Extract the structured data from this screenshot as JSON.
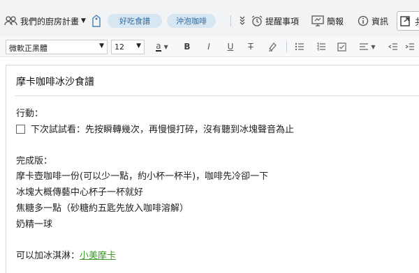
{
  "toolbar": {
    "notebook_name": "我們的廚房計畫",
    "tags": [
      "好吃食譜",
      "沖泡咖啡"
    ],
    "reminder_label": "提醒事項",
    "presentation_label": "簡報",
    "info_label": "資訊",
    "share_label": "共"
  },
  "format": {
    "font": "微軟正黑體",
    "size": "12",
    "buttons": [
      "text-color",
      "bold",
      "italic",
      "underline",
      "strikethrough",
      "highlight",
      "bulleted-list",
      "numbered-list",
      "checkbox",
      "align",
      "outdent",
      "indent"
    ]
  },
  "note": {
    "title": "摩卡咖啡冰沙食譜",
    "action_heading": "行動：",
    "todo_item": "下次試試看：先按瞬轉幾次，再慢慢打碎，沒有聽到冰塊聲音為止",
    "finished_heading": "完成版：",
    "steps": [
      "摩卡壺咖啡一份(可以少一點，約小杯一杯半)，咖啡先冷卻一下",
      "冰塊大概傳藝中心杯子一杯就好",
      "焦糖多一點（砂糖約五匙先放入咖啡溶解）",
      "奶精一球"
    ],
    "extra_prefix": "可以加冰淇淋：",
    "extra_link": "小美摩卡"
  },
  "colors": {
    "tag_bg": "#d7e6f3",
    "tag_text": "#2f6a9a",
    "link": "#3a9a25"
  }
}
